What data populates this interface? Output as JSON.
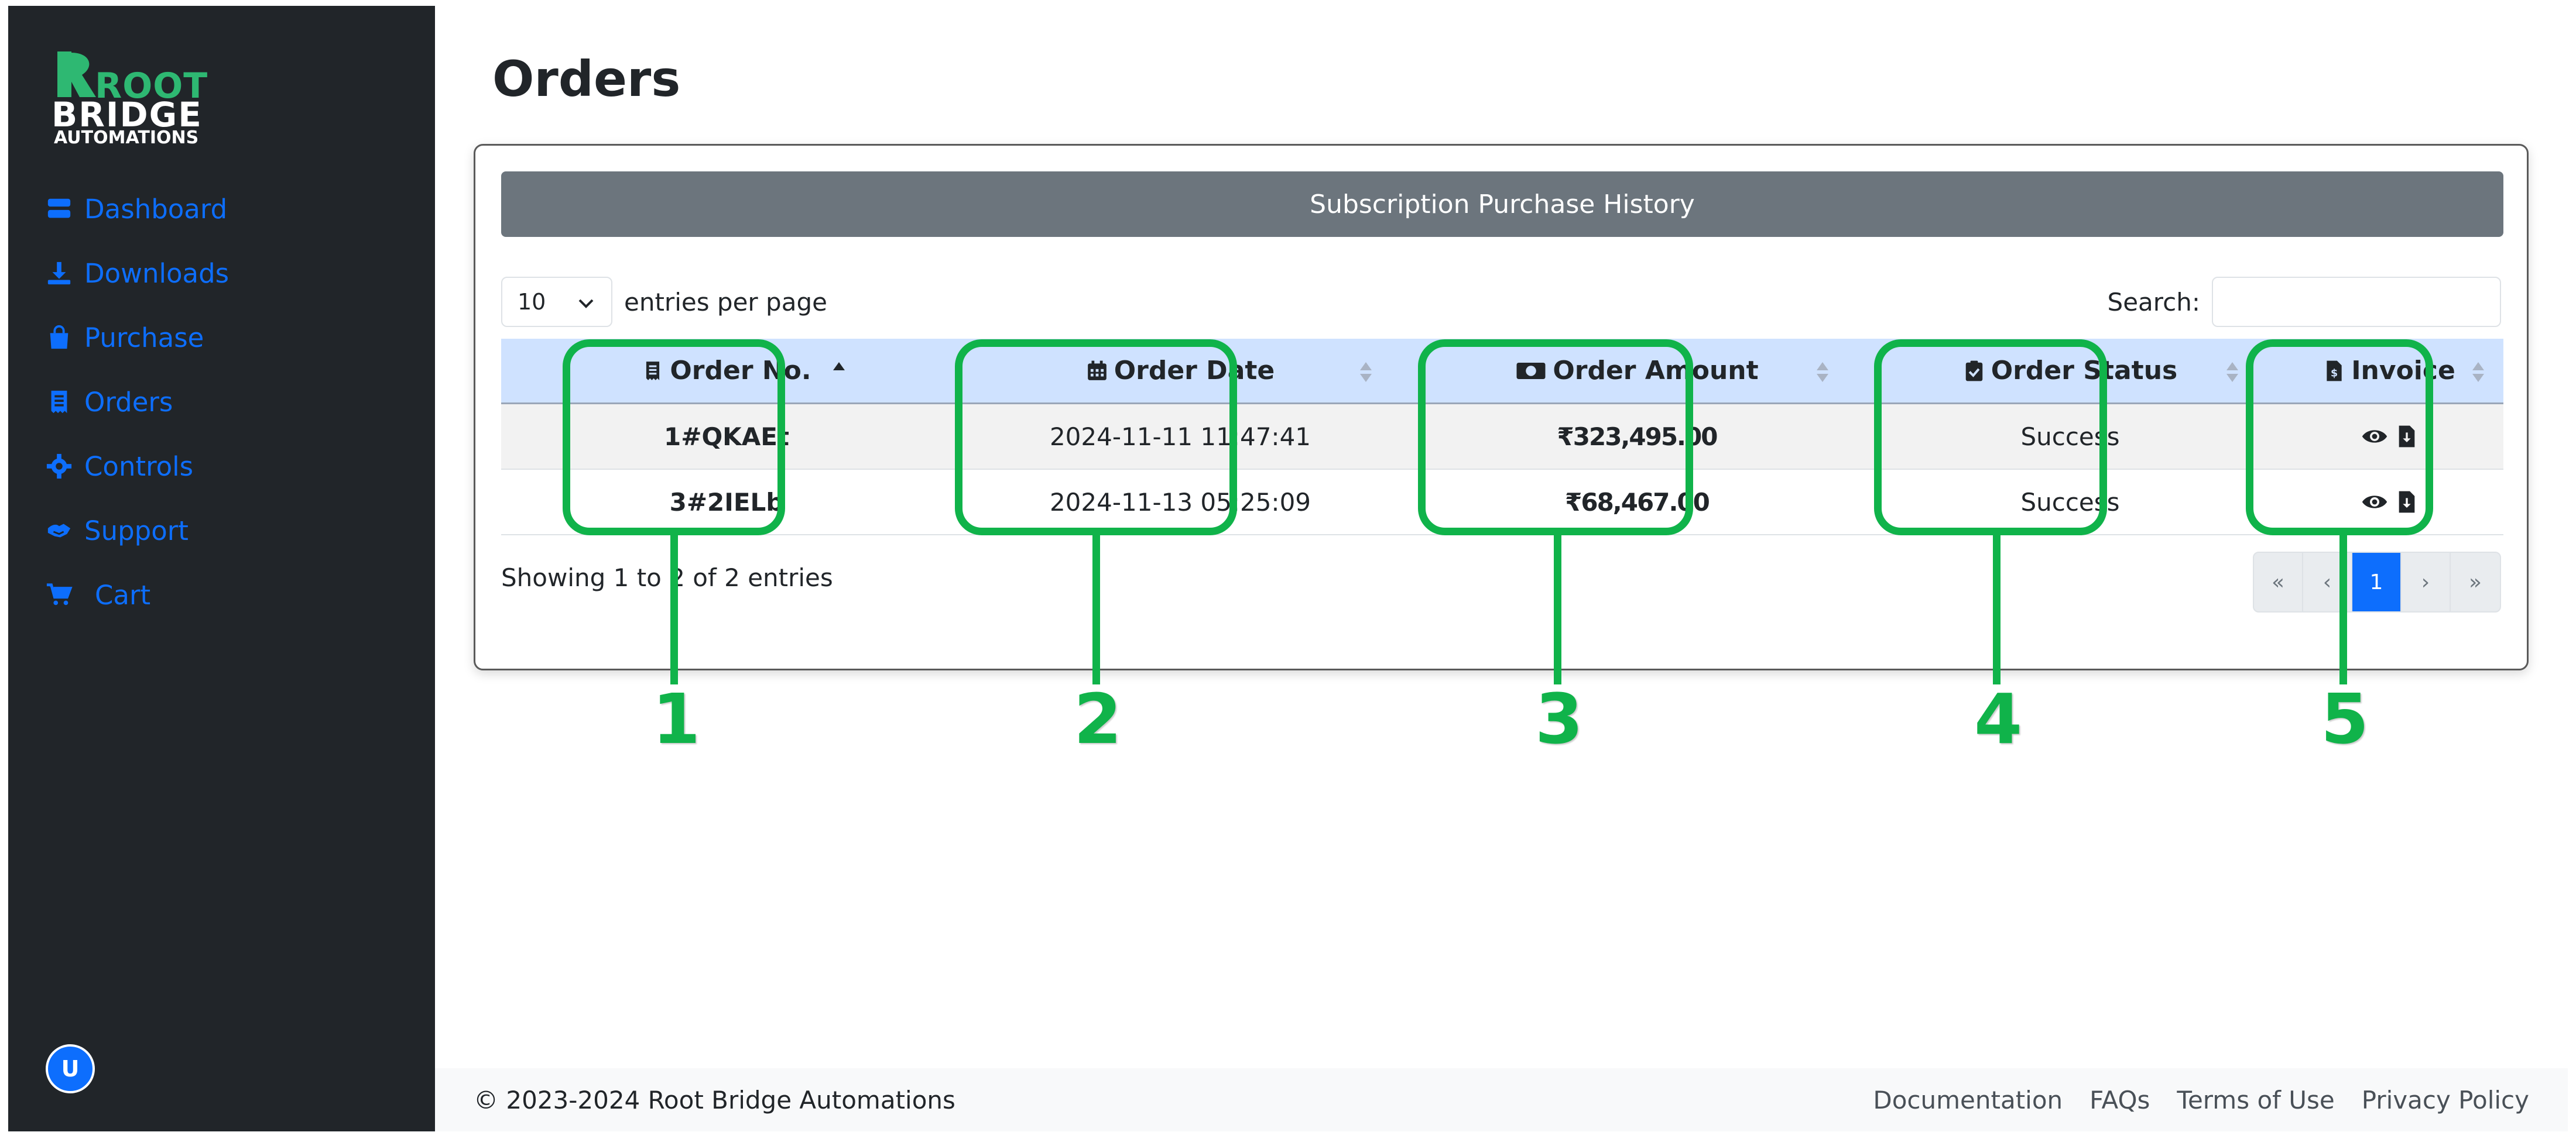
{
  "sidebar": {
    "logo": {
      "line1": "ROOT",
      "line2": "BRIDGE",
      "line3": "AUTOMATIONS"
    },
    "items": [
      {
        "label": "Dashboard",
        "icon": "dashboard-icon"
      },
      {
        "label": "Downloads",
        "icon": "download-icon"
      },
      {
        "label": "Purchase",
        "icon": "shopping-bag-icon"
      },
      {
        "label": "Orders",
        "icon": "receipt-icon"
      },
      {
        "label": "Controls",
        "icon": "gear-icon"
      },
      {
        "label": "Support",
        "icon": "handshake-icon"
      },
      {
        "label": "Cart",
        "icon": "cart-icon"
      }
    ],
    "avatar": "U"
  },
  "page": {
    "title": "Orders"
  },
  "card": {
    "header": "Subscription Purchase History"
  },
  "table_controls": {
    "entries_value": "10",
    "entries_label": "entries per page",
    "search_label": "Search:",
    "search_placeholder": ""
  },
  "table": {
    "columns": [
      "Order No.",
      "Order Date",
      "Order Amount",
      "Order Status",
      "Invoice"
    ],
    "rows": [
      {
        "order_no": "1#QKAEt",
        "order_date": "2024-11-11 11:47:41",
        "order_amount": "₹323,495.00",
        "order_status": "Success"
      },
      {
        "order_no": "3#2IELb",
        "order_date": "2024-11-13 05:25:09",
        "order_amount": "₹68,467.00",
        "order_status": "Success"
      }
    ]
  },
  "info_text": "Showing 1 to 2 of 2 entries",
  "pagination": {
    "first": "«",
    "prev": "‹",
    "current": "1",
    "next": "›",
    "last": "»"
  },
  "footer": {
    "copyright": "© 2023-2024 Root Bridge Automations",
    "links": [
      "Documentation",
      "FAQs",
      "Terms of Use",
      "Privacy Policy"
    ]
  },
  "annotations": [
    "1",
    "2",
    "3",
    "4",
    "5"
  ],
  "colors": {
    "sidebar_bg": "#212529",
    "accent": "#0d6efd",
    "annotation": "#10b34a",
    "header_row": "#cfe2ff",
    "card_header": "#6c757d"
  }
}
